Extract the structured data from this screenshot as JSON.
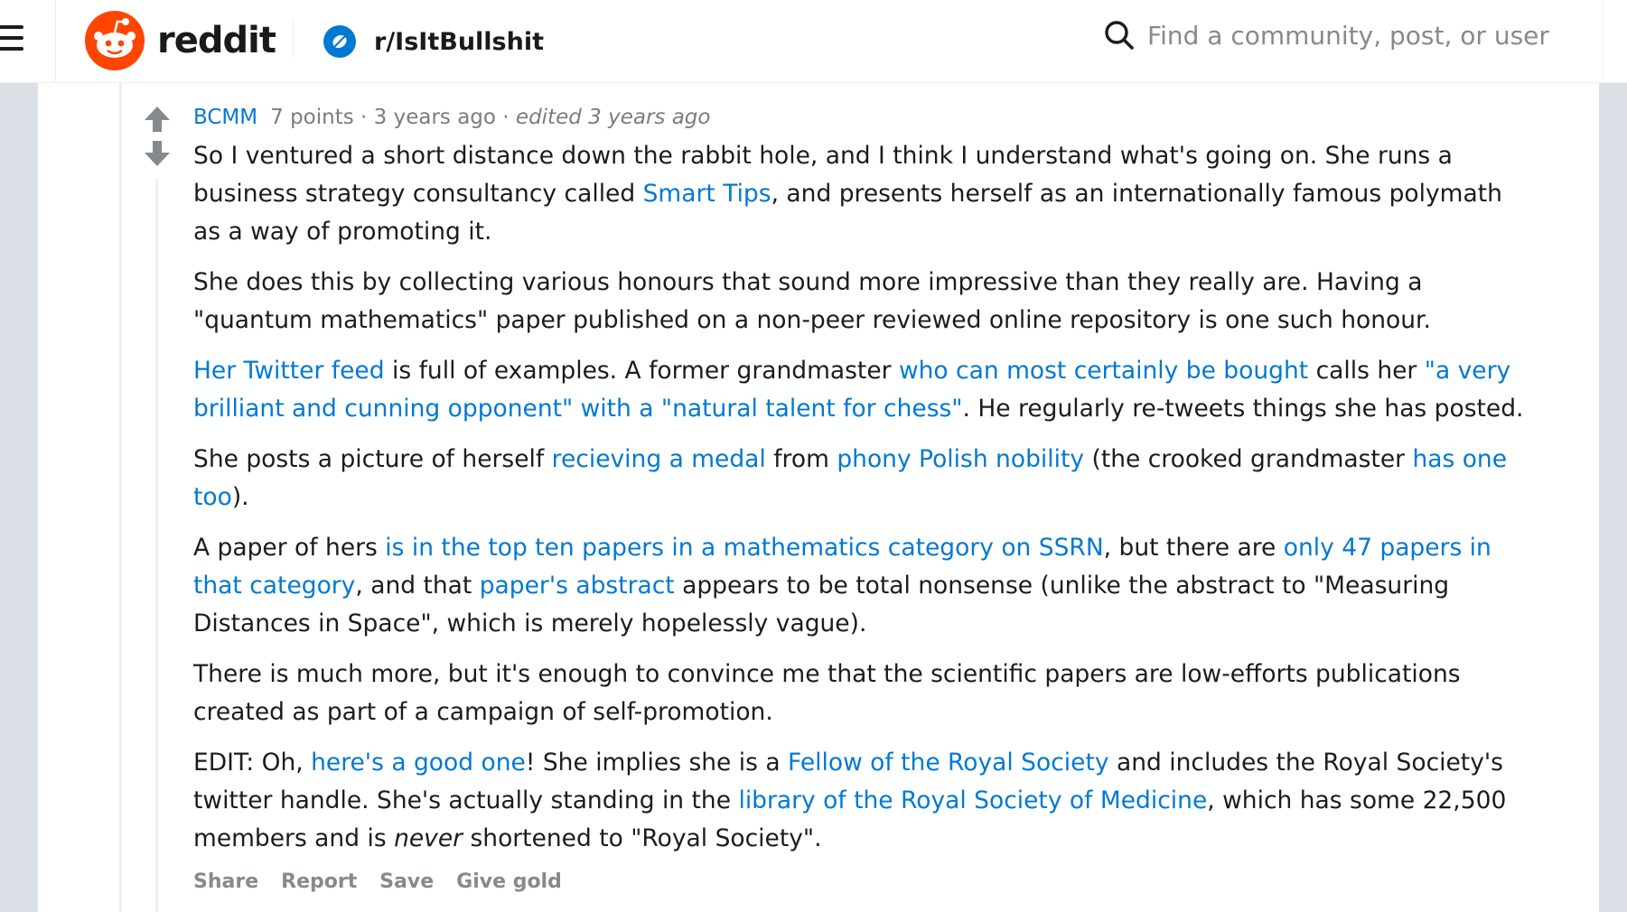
{
  "header": {
    "logo_text": "reddit",
    "subreddit": "r/IsItBullshit",
    "search_placeholder": "Find a community, post, or user"
  },
  "comment": {
    "author": "BCMM",
    "points": "7 points",
    "sep": " · ",
    "time": "3 years ago",
    "sep2": " · ",
    "edited": "edited 3 years ago",
    "paragraphs": {
      "p1": {
        "t1": "So I ventured a short distance down the rabbit hole, and I think I understand what's going on. She runs a business strategy consultancy called ",
        "l1": "Smart Tips",
        "t2": ", and presents herself as an internationally famous polymath as a way of promoting it."
      },
      "p2": {
        "t1": "She does this by collecting various honours that sound more impressive than they really are. Having a \"quantum mathematics\" paper published on a non-peer reviewed online repository is one such honour."
      },
      "p3": {
        "l1": "Her Twitter feed",
        "t1": " is full of examples. A former grandmaster ",
        "l2": "who can most certainly be bought",
        "t2": " calls her ",
        "l3": "\"a very brilliant and cunning opponent\" with a \"natural talent for chess\"",
        "t3": ". He regularly re-tweets things she has posted."
      },
      "p4": {
        "t1": "She posts a picture of herself ",
        "l1": "recieving a medal",
        "t2": " from ",
        "l2": "phony Polish nobility",
        "t3": " (the crooked grandmaster ",
        "l3": "has one too",
        "t4": ")."
      },
      "p5": {
        "t1": "A paper of hers ",
        "l1": "is in the top ten papers in a mathematics category on SSRN",
        "t2": ", but there are ",
        "l2": "only 47 papers in that category",
        "t3": ", and that ",
        "l3": "paper's abstract",
        "t4": " appears to be total nonsense (unlike the abstract to \"Measuring Distances in Space\", which is merely hopelessly vague)."
      },
      "p6": {
        "t1": "There is much more, but it's enough to convince me that the scientific papers are low-efforts publications created as part of a campaign of self-promotion."
      },
      "p7": {
        "t1": "EDIT: Oh, ",
        "l1": "here's a good one",
        "t2": "! She implies she is a ",
        "l2": "Fellow of the Royal Society",
        "t3": " and includes the Royal Society's twitter handle. She's actually standing in the ",
        "l3": "library of the Royal Society of Medicine",
        "t4": ", which has some 22,500 members and is ",
        "em": "never",
        "t5": " shortened to \"Royal Society\"."
      }
    },
    "actions": {
      "share": "Share",
      "report": "Report",
      "save": "Save",
      "give_gold": "Give gold"
    }
  },
  "colors": {
    "accent": "#0079d3",
    "brand": "#ff4500",
    "background": "#dae0e6"
  }
}
